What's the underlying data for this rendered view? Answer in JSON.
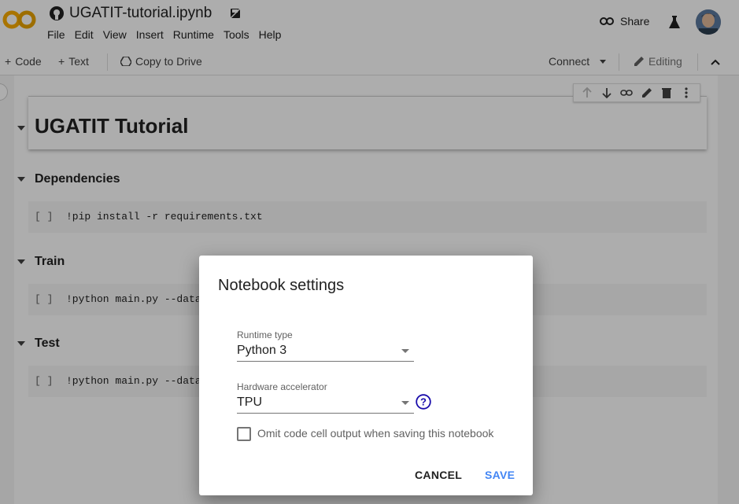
{
  "header": {
    "notebook_title": "UGATIT-tutorial.ipynb",
    "menu": [
      "File",
      "Edit",
      "View",
      "Insert",
      "Runtime",
      "Tools",
      "Help"
    ],
    "share_label": "Share"
  },
  "toolbar": {
    "code_label": "Code",
    "text_label": "Text",
    "copy_label": "Copy to Drive",
    "connect_label": "Connect",
    "editing_label": "Editing"
  },
  "notebook": {
    "title": "UGATIT Tutorial",
    "sections": [
      {
        "heading": "Dependencies",
        "code": "!pip install -r requirements.txt"
      },
      {
        "heading": "Train",
        "code": "!python main.py --data"
      },
      {
        "heading": "Test",
        "code": "!python main.py --data"
      }
    ],
    "cell_bracket": "[ ]"
  },
  "dialog": {
    "title": "Notebook settings",
    "runtime_label": "Runtime type",
    "runtime_value": "Python 3",
    "accelerator_label": "Hardware accelerator",
    "accelerator_value": "TPU",
    "omit_label": "Omit code cell output when saving this notebook",
    "omit_checked": false,
    "cancel_label": "CANCEL",
    "save_label": "SAVE"
  },
  "colors": {
    "accent": "#4285f4",
    "logo_orange": "#f9ab00",
    "help_blue": "#1a0dab"
  }
}
